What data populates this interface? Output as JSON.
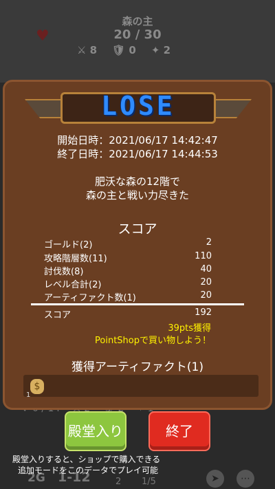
{
  "background": {
    "enemy_name": "森の主",
    "enemy_hp": "20 / 30",
    "enemy_stats": [
      "8",
      "0",
      "2"
    ],
    "bottom_row": [
      "0 / 14",
      "2",
      "2",
      "1"
    ],
    "footer": {
      "floor": "2G",
      "level": "1-12",
      "count": "2",
      "page": "1/5"
    }
  },
  "result": {
    "title": "LOSE",
    "start_label": "開始日時：2021/06/17 14:42:47",
    "end_label": "終了日時：2021/06/17 14:44:53",
    "message_line1": "肥沃な森の12階で",
    "message_line2": "森の主と戦い力尽きた"
  },
  "score": {
    "header": "スコア",
    "rows": [
      {
        "label": "ゴールド(2)",
        "value": "2"
      },
      {
        "label": "攻略階層数(11)",
        "value": "110"
      },
      {
        "label": "討伐数(8)",
        "value": "40"
      },
      {
        "label": "レベル合計(2)",
        "value": "20"
      },
      {
        "label": "アーティファクト数(1)",
        "value": "20"
      }
    ],
    "total_label": "スコア",
    "total_value": "192",
    "pts": "39pts獲得",
    "shop": "PointShopで買い物しよう！"
  },
  "artifacts": {
    "header": "獲得アーティファクト(1)",
    "count": "1"
  },
  "buttons": {
    "hall": "殿堂入り",
    "end": "終了"
  },
  "note": {
    "line1": "殿堂入りすると、ショップで購入できる",
    "line2": "追加モードをこのデータでプレイ可能"
  },
  "colors": {
    "panel": "#6a3e22",
    "title": "#2f8bff",
    "highlight": "#fff200",
    "hall_button": "#8dc63f",
    "end_button": "#e02b20"
  }
}
